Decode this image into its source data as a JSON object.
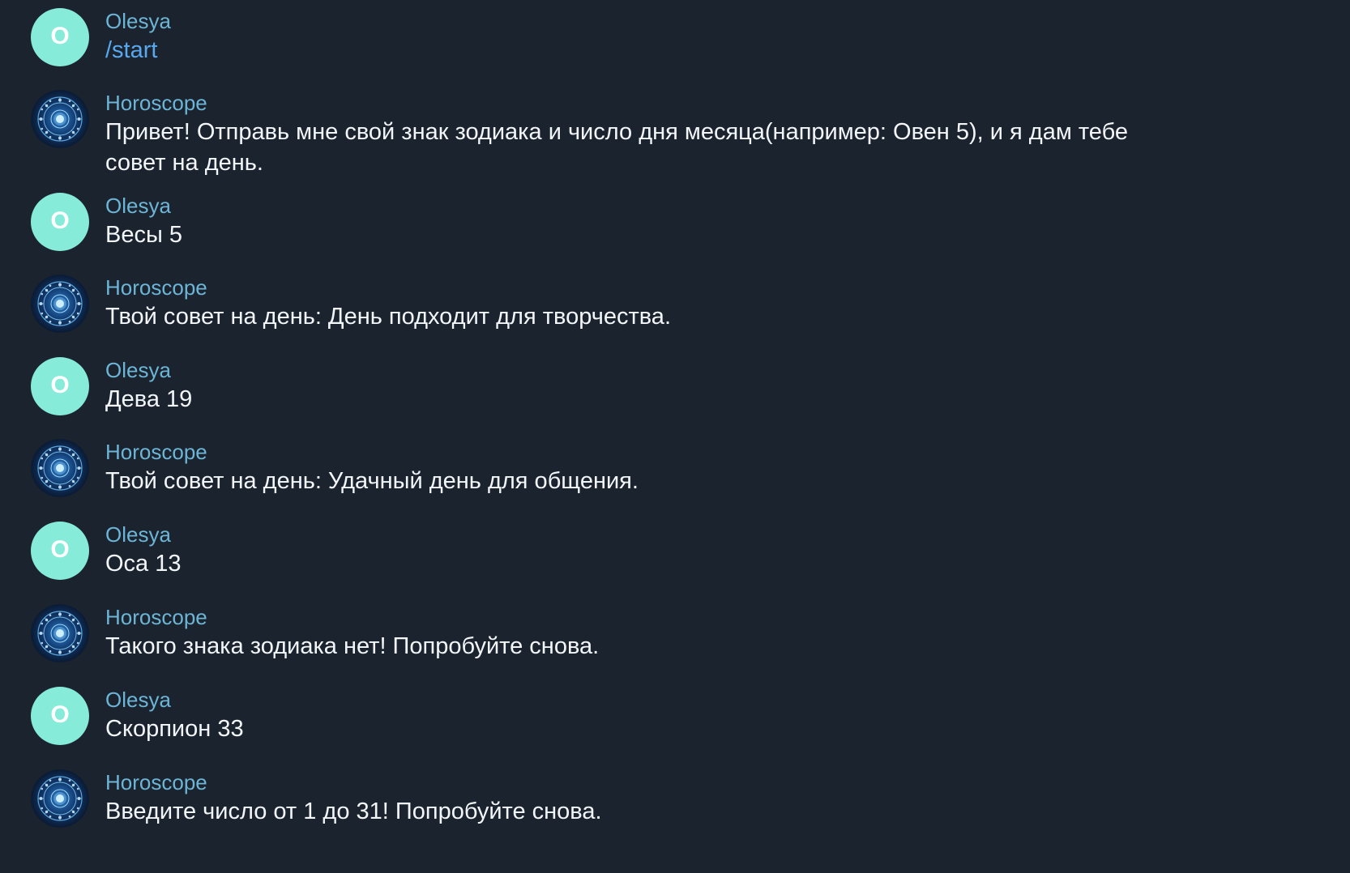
{
  "messages": [
    {
      "author": "Olesya",
      "avatar_letter": "O",
      "text": "/start",
      "is_command": true
    },
    {
      "author": "Horoscope",
      "avatar_icon": "zodiac-wheel-icon",
      "text": "Привет! Отправь мне свой знак зодиака и число дня месяца(например: Овен 5), и я дам тебе совет на день."
    },
    {
      "author": "Olesya",
      "avatar_letter": "O",
      "text": "Весы 5"
    },
    {
      "author": "Horoscope",
      "avatar_icon": "zodiac-wheel-icon",
      "text": "Твой совет на день: День подходит для творчества."
    },
    {
      "author": "Olesya",
      "avatar_letter": "O",
      "text": "Дева 19"
    },
    {
      "author": "Horoscope",
      "avatar_icon": "zodiac-wheel-icon",
      "text": "Твой совет на день: Удачный день для общения."
    },
    {
      "author": "Olesya",
      "avatar_letter": "O",
      "text": "Оса 13"
    },
    {
      "author": "Horoscope",
      "avatar_icon": "zodiac-wheel-icon",
      "text": "Такого знака зодиака нет! Попробуйте снова."
    },
    {
      "author": "Olesya",
      "avatar_letter": "O",
      "text": "Скорпион 33"
    },
    {
      "author": "Horoscope",
      "avatar_icon": "zodiac-wheel-icon",
      "text": "Введите число от 1 до 31! Попробуйте снова."
    }
  ],
  "colors": {
    "background": "#1b232e",
    "author_name": "#6cb5d6",
    "message_text": "#f3f6f9",
    "command_link": "#59a9f0",
    "user_avatar": "#86ebd9"
  }
}
